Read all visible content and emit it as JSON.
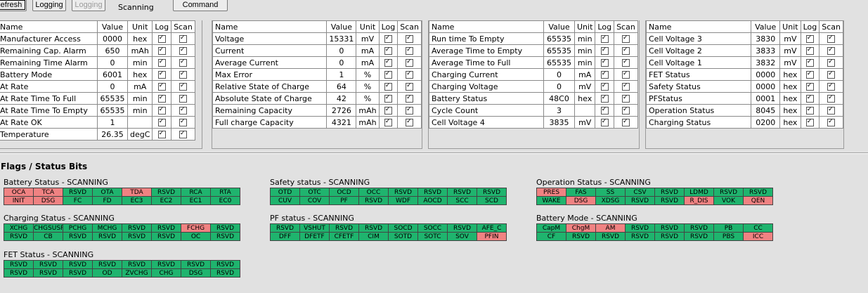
{
  "toolbar": {
    "refresh_label": "Refresh",
    "logging_label": "Logging",
    "logging_disabled_label": "Logging",
    "scanning_label": "Scanning",
    "command_label": "Command"
  },
  "table_headers": {
    "name": "Name",
    "value": "Value",
    "unit": "Unit",
    "log": "Log",
    "scan": "Scan"
  },
  "tables": [
    {
      "rows": [
        {
          "name": "Manufacturer Access",
          "value": "0000",
          "unit": "hex"
        },
        {
          "name": "Remaining Cap. Alarm",
          "value": "650",
          "unit": "mAh"
        },
        {
          "name": "Remaining Time Alarm",
          "value": "0",
          "unit": "min"
        },
        {
          "name": "Battery Mode",
          "value": "6001",
          "unit": "hex"
        },
        {
          "name": "At Rate",
          "value": "0",
          "unit": "mA"
        },
        {
          "name": "At Rate Time To Full",
          "value": "65535",
          "unit": "min"
        },
        {
          "name": "At Rate Time To Empty",
          "value": "65535",
          "unit": "min"
        },
        {
          "name": "At Rate OK",
          "value": "1",
          "unit": ""
        },
        {
          "name": "Temperature",
          "value": "26.35",
          "unit": "degC"
        }
      ]
    },
    {
      "rows": [
        {
          "name": "Voltage",
          "value": "15331",
          "unit": "mV"
        },
        {
          "name": "Current",
          "value": "0",
          "unit": "mA"
        },
        {
          "name": "Average Current",
          "value": "0",
          "unit": "mA"
        },
        {
          "name": "Max Error",
          "value": "1",
          "unit": "%"
        },
        {
          "name": "Relative State of Charge",
          "value": "64",
          "unit": "%"
        },
        {
          "name": "Absolute State of Charge",
          "value": "42",
          "unit": "%"
        },
        {
          "name": "Remaining Capacity",
          "value": "2726",
          "unit": "mAh"
        },
        {
          "name": "Full charge Capacity",
          "value": "4321",
          "unit": "mAh"
        }
      ]
    },
    {
      "rows": [
        {
          "name": "Run time To Empty",
          "value": "65535",
          "unit": "min"
        },
        {
          "name": "Average Time to Empty",
          "value": "65535",
          "unit": "min"
        },
        {
          "name": "Average Time to Full",
          "value": "65535",
          "unit": "min"
        },
        {
          "name": "Charging Current",
          "value": "0",
          "unit": "mA"
        },
        {
          "name": "Charging Voltage",
          "value": "0",
          "unit": "mV"
        },
        {
          "name": "Battery Status",
          "value": "48C0",
          "unit": "hex"
        },
        {
          "name": "Cycle Count",
          "value": "3",
          "unit": ""
        },
        {
          "name": "Cell Voltage 4",
          "value": "3835",
          "unit": "mV"
        }
      ]
    },
    {
      "rows": [
        {
          "name": "Cell Voltage 3",
          "value": "3830",
          "unit": "mV"
        },
        {
          "name": "Cell Voltage 2",
          "value": "3833",
          "unit": "mV"
        },
        {
          "name": "Cell Voltage 1",
          "value": "3832",
          "unit": "mV"
        },
        {
          "name": "FET Status",
          "value": "0000",
          "unit": "hex"
        },
        {
          "name": "Safety Status",
          "value": "0000",
          "unit": "hex"
        },
        {
          "name": "PFStatus",
          "value": "0001",
          "unit": "hex"
        },
        {
          "name": "Operation Status",
          "value": "8045",
          "unit": "hex"
        },
        {
          "name": "Charging Status",
          "value": "0200",
          "unit": "hex"
        }
      ]
    }
  ],
  "flags_title": "Flags / Status Bits",
  "colors": {
    "bit_off": "#1fb46e",
    "bit_on": "#f08282"
  },
  "flag_groups": [
    {
      "title": "Battery Status - SCANNING",
      "bits": [
        [
          "OCA",
          1
        ],
        [
          "TCA",
          1
        ],
        [
          "RSVD",
          0
        ],
        [
          "OTA",
          0
        ],
        [
          "TDA",
          1
        ],
        [
          "RSVD",
          0
        ],
        [
          "RCA",
          0
        ],
        [
          "RTA",
          0
        ],
        [
          "INIT",
          1
        ],
        [
          "DSG",
          1
        ],
        [
          "FC",
          0
        ],
        [
          "FD",
          0
        ],
        [
          "EC3",
          0
        ],
        [
          "EC2",
          0
        ],
        [
          "EC1",
          0
        ],
        [
          "EC0",
          0
        ]
      ]
    },
    {
      "title": "Safety status - SCANNING",
      "bits": [
        [
          "OTD",
          0
        ],
        [
          "OTC",
          0
        ],
        [
          "OCD",
          0
        ],
        [
          "OCC",
          0
        ],
        [
          "RSVD",
          0
        ],
        [
          "RSVD",
          0
        ],
        [
          "RSVD",
          0
        ],
        [
          "RSVD",
          0
        ],
        [
          "CUV",
          0
        ],
        [
          "COV",
          0
        ],
        [
          "PF",
          0
        ],
        [
          "RSVD",
          0
        ],
        [
          "WDF",
          0
        ],
        [
          "AOCD",
          0
        ],
        [
          "SCC",
          0
        ],
        [
          "SCD",
          0
        ]
      ]
    },
    {
      "title": "Operation Status - SCANNING",
      "bits": [
        [
          "PRES",
          1
        ],
        [
          "FAS",
          0
        ],
        [
          "SS",
          0
        ],
        [
          "CSV",
          0
        ],
        [
          "RSVD",
          0
        ],
        [
          "LDMD",
          0
        ],
        [
          "RSVD",
          0
        ],
        [
          "RSVD",
          0
        ],
        [
          "WAKE",
          0
        ],
        [
          "DSG",
          1
        ],
        [
          "XDSG",
          0
        ],
        [
          "RSVD",
          0
        ],
        [
          "RSVD",
          0
        ],
        [
          "R_DIS",
          1
        ],
        [
          "VOK",
          0
        ],
        [
          "QEN",
          1
        ]
      ]
    },
    {
      "title": "Charging Status - SCANNING",
      "bits": [
        [
          "XCHG",
          0
        ],
        [
          "CHGSUSP",
          0
        ],
        [
          "PCHG",
          0
        ],
        [
          "MCHG",
          0
        ],
        [
          "RSVD",
          0
        ],
        [
          "RSVD",
          0
        ],
        [
          "FCHG",
          1
        ],
        [
          "RSVD",
          0
        ],
        [
          "RSVD",
          0
        ],
        [
          "CB",
          0
        ],
        [
          "RSVD",
          0
        ],
        [
          "RSVD",
          0
        ],
        [
          "RSVD",
          0
        ],
        [
          "RSVD",
          0
        ],
        [
          "OC",
          0
        ],
        [
          "RSVD",
          0
        ]
      ]
    },
    {
      "title": "PF status - SCANNING",
      "bits": [
        [
          "RSVD",
          0
        ],
        [
          "VSHUT",
          0
        ],
        [
          "RSVD",
          0
        ],
        [
          "RSVD",
          0
        ],
        [
          "SOCD",
          0
        ],
        [
          "SOCC",
          0
        ],
        [
          "RSVD",
          0
        ],
        [
          "AFE_C",
          0
        ],
        [
          "DFF",
          0
        ],
        [
          "DFETF",
          0
        ],
        [
          "CFETF",
          0
        ],
        [
          "CIM",
          0
        ],
        [
          "SOTD",
          0
        ],
        [
          "SOTC",
          0
        ],
        [
          "SOV",
          0
        ],
        [
          "PFIN",
          1
        ]
      ]
    },
    {
      "title": "Battery Mode - SCANNING",
      "bits": [
        [
          "CapM",
          0
        ],
        [
          "ChgM",
          1
        ],
        [
          "AM",
          1
        ],
        [
          "RSVD",
          0
        ],
        [
          "RSVD",
          0
        ],
        [
          "RSVD",
          0
        ],
        [
          "PB",
          0
        ],
        [
          "CC",
          0
        ],
        [
          "CF",
          0
        ],
        [
          "RSVD",
          0
        ],
        [
          "RSVD",
          0
        ],
        [
          "RSVD",
          0
        ],
        [
          "RSVD",
          0
        ],
        [
          "RSVD",
          0
        ],
        [
          "PBS",
          0
        ],
        [
          "ICC",
          1
        ]
      ]
    },
    {
      "title": "FET Status - SCANNING",
      "bits": [
        [
          "RSVD",
          0
        ],
        [
          "RSVD",
          0
        ],
        [
          "RSVD",
          0
        ],
        [
          "RSVD",
          0
        ],
        [
          "RSVD",
          0
        ],
        [
          "RSVD",
          0
        ],
        [
          "RSVD",
          0
        ],
        [
          "RSVD",
          0
        ],
        [
          "RSVD",
          0
        ],
        [
          "RSVD",
          0
        ],
        [
          "RSVD",
          0
        ],
        [
          "OD",
          0
        ],
        [
          "ZVCHG",
          0
        ],
        [
          "CHG",
          0
        ],
        [
          "DSG",
          0
        ],
        [
          "RSVD",
          0
        ]
      ]
    }
  ]
}
